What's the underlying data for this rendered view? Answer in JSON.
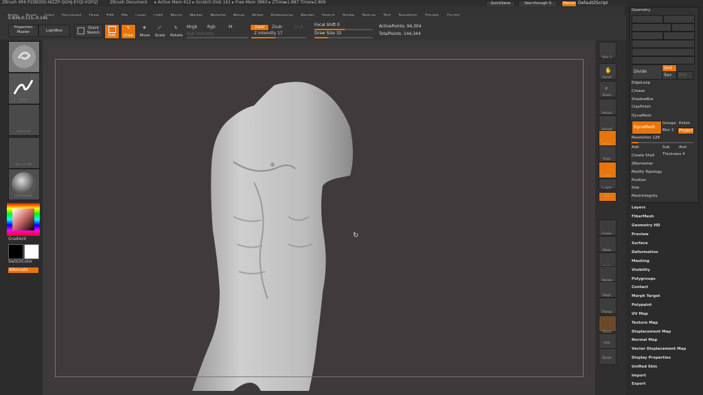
{
  "titlebar": {
    "app": "ZBrush 4R6 P2[BDDG-WZZP-QOHJ-EYQI-VGFQ]",
    "document": "ZBrush Document",
    "stats": "▸ Active Mem 412 ▸ Scratch Disk 161 ▸ Free Mem 3883 ▸ ZTime▸1.887 Timer▸2.806",
    "quicksave": "QuickSave",
    "seethrough": "See-through",
    "seethrough_value": "0",
    "menus": "Menus",
    "defaultscript": "DefaultZScript"
  },
  "menubar": {
    "items": [
      "Alpha",
      "Brush",
      "Color",
      "Document",
      "Draw",
      "Edit",
      "File",
      "Layer",
      "Light",
      "Macro",
      "Marker",
      "Material",
      "Movie",
      "Picker",
      "Preferences",
      "Render",
      "Stencil",
      "Stroke",
      "Texture",
      "Tool",
      "Transform",
      "Zplugin",
      "Zscript"
    ]
  },
  "coords": "0.836,0.115,-0.145",
  "shelf": {
    "projection_master": "Projection Master",
    "lightbox": "LightBox",
    "quick_sketch": "Quick Sketch",
    "edit": "Edit",
    "draw": "Draw",
    "move": "Move",
    "scale": "Scale",
    "rotate": "Rotate",
    "mrgb": "Mrgb",
    "rgb": "Rgb",
    "m": "M",
    "rgb_intensity": "Rgb Intensity",
    "zadd": "Zadd",
    "zsub": "Zsub",
    "zcut": "Zcut",
    "z_intensity_label": "Z Intensity",
    "z_intensity_value": "17",
    "focal_shift_label": "Focal Shift",
    "focal_shift_value": "0",
    "draw_size_label": "Draw Size",
    "draw_size_value": "32",
    "active_points_label": "ActivePoints:",
    "active_points_value": "94,304",
    "total_points_label": "TotalPoints:",
    "total_points_value": "144,344"
  },
  "left_tray": {
    "thumbs": [
      "Standard",
      "Dots",
      "Alpha Off",
      "Texture Off",
      "SkinShade4"
    ],
    "gradient": "Gradient",
    "switchcolor": "SwitchColor",
    "alternate": "Alternate"
  },
  "right_shelf": {
    "labels": [
      "SPix 3",
      "Scroll",
      "Zoom",
      "Actual",
      "AAHalf",
      "Persp",
      "Floor",
      "Local",
      "L.Sym",
      "Xyz",
      "Frame",
      "Move",
      "Scale",
      "Rotate",
      "PolyF",
      "Transp",
      "Ghost",
      "Solo",
      "Xpose"
    ]
  },
  "geometry_panel": {
    "title": "Geometry",
    "divide": "Divide",
    "smt": "Smt",
    "suv": "Suv",
    "rstr": "Rstr",
    "edgeloop": "EdgeLoop",
    "crease": "Crease",
    "shadowbox": "ShadowBox",
    "claypolish": "ClayPolish",
    "dynamesh_header": "DynaMesh",
    "dynamesh_btn": "DynaMesh",
    "groups": "Groups",
    "polish": "Polish",
    "blur": "Blur",
    "blur_value": "2",
    "project": "Project",
    "resolution": "Resolution",
    "resolution_value": "128",
    "add": "Add",
    "sub": "Sub",
    "and": "And",
    "create_shell": "Create Shell",
    "thickness": "Thickness",
    "thickness_value": "4",
    "zremesher": "ZRemesher",
    "modify_topology": "Modify Topology",
    "position": "Position",
    "size": "Size",
    "meshintegrity": "MeshIntegrity"
  },
  "tool_subpalettes": [
    "Layers",
    "FiberMesh",
    "Geometry HD",
    "Preview",
    "Surface",
    "Deformation",
    "Masking",
    "Visibility",
    "Polygroups",
    "Contact",
    "Morph Target",
    "Polypaint",
    "UV Map",
    "Texture Map",
    "Displacement Map",
    "Normal Map",
    "Vector Displacement Map",
    "Display Properties",
    "Unified Skin",
    "Import",
    "Export"
  ],
  "colors": {
    "accent": "#e8750b",
    "background": "#403a3c",
    "mesh": "#c9c9c9"
  }
}
